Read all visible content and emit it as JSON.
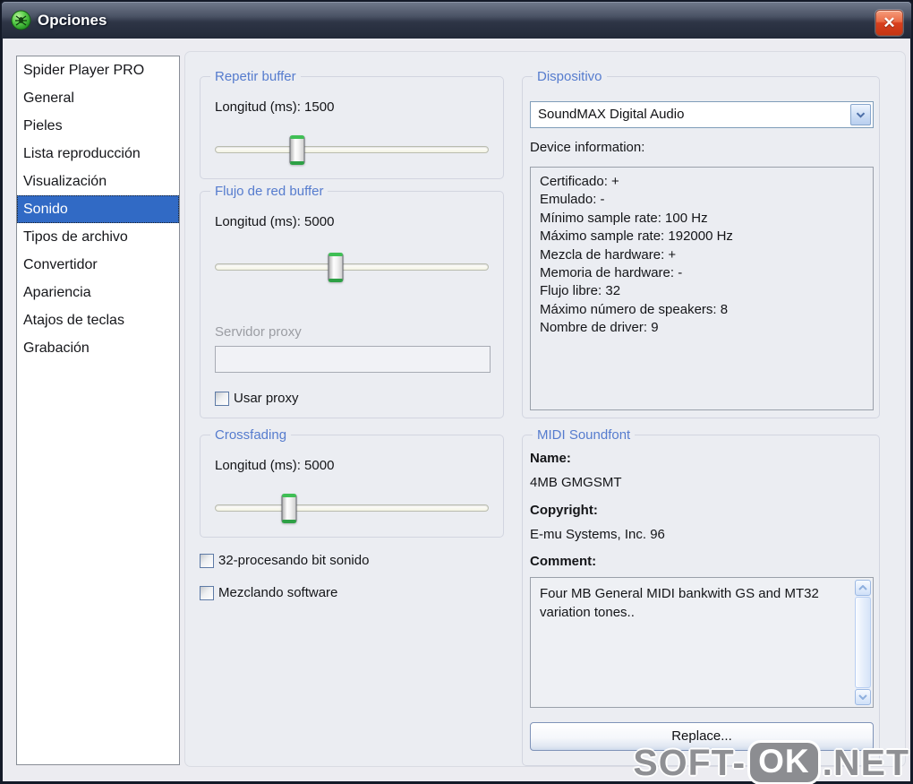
{
  "window": {
    "title": "Opciones",
    "close_glyph": "✕"
  },
  "sidebar": {
    "items": [
      {
        "label": "Spider Player PRO"
      },
      {
        "label": "General"
      },
      {
        "label": "Pieles"
      },
      {
        "label": "Lista reproducción"
      },
      {
        "label": "Visualización"
      },
      {
        "label": "Sonido",
        "selected": true
      },
      {
        "label": "Tipos de archivo"
      },
      {
        "label": "Convertidor"
      },
      {
        "label": "Apariencia"
      },
      {
        "label": "Atajos de teclas"
      },
      {
        "label": "Grabación"
      }
    ]
  },
  "groups": {
    "repeat_buffer": {
      "title": "Repetir buffer",
      "length_label": "Longitud (ms): 1500",
      "slider_percent": "30%"
    },
    "net_buffer": {
      "title": "Flujo de red buffer",
      "length_label": "Longitud (ms): 5000",
      "slider_percent": "44%",
      "proxy_label": "Servidor proxy",
      "proxy_value": "",
      "use_proxy_label": "Usar proxy"
    },
    "crossfading": {
      "title": "Crossfading",
      "length_label": "Longitud (ms): 5000",
      "slider_percent": "27%"
    },
    "device": {
      "title": "Dispositivo",
      "selected_device": "SoundMAX Digital Audio",
      "info_label": "Device information:",
      "info_lines": [
        "Certificado: +",
        "Emulado: -",
        "Mínimo sample rate: 100 Hz",
        "Máximo sample rate: 192000 Hz",
        "Mezcla de hardware: +",
        "Memoria de hardware: -",
        "Flujo libre: 32",
        "Máximo número de speakers: 8",
        "Nombre de driver: 9"
      ]
    },
    "midi": {
      "title": "MIDI Soundfont",
      "name_label": "Name:",
      "name_value": "4MB GMGSMT",
      "copyright_label": "Copyright:",
      "copyright_value": "E-mu Systems, Inc. 96",
      "comment_label": "Comment:",
      "comment_value": "Four MB General MIDI bankwith GS and MT32 variation tones..",
      "replace_label": "Replace..."
    }
  },
  "checkboxes": {
    "bits32_label": "32-procesando bit sonido",
    "software_mix_label": "Mezclando software"
  },
  "watermark": {
    "part1": "SOFT-",
    "badge": "OK",
    "part2": ".NET"
  },
  "colors": {
    "titlebar_dark": "#222938",
    "selection_blue": "#316ac5",
    "group_title_blue": "#567cce",
    "close_red": "#d8401f",
    "slider_green": "#3fbf55",
    "dialog_bg": "#ececf1"
  }
}
